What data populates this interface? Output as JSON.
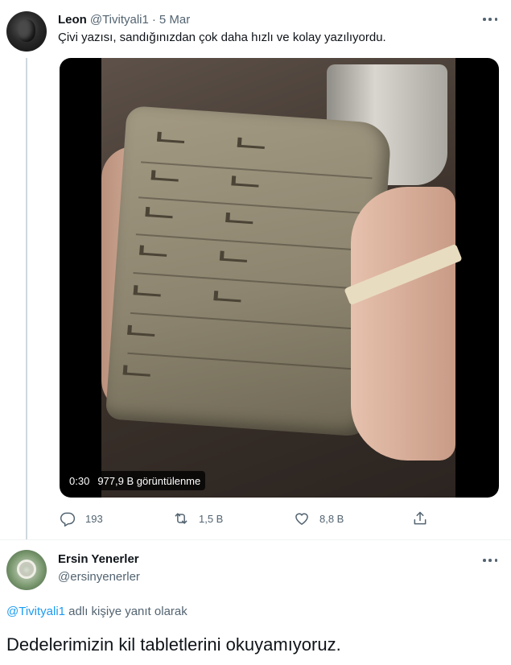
{
  "tweet": {
    "author_name": "Leon",
    "author_handle": "@Tivityali1",
    "separator": "·",
    "date": "5 Mar",
    "text": "Çivi yazısı, sandığınızdan çok daha hızlı ve kolay yazılıyordu.",
    "video": {
      "duration": "0:30",
      "views": "977,9 B görüntülenme"
    },
    "stats": {
      "replies": "193",
      "retweets": "1,5 B",
      "likes": "8,8 B"
    }
  },
  "reply": {
    "author_name": "Ersin Yenerler",
    "author_handle": "@ersinyenerler",
    "replying_to_handle": "@Tivityali1",
    "replying_to_suffix": " adlı kişiye yanıt olarak",
    "text": "Dedelerimizin kil tabletlerini okuyamıyoruz."
  },
  "colors": {
    "text_primary": "#0f1419",
    "text_secondary": "#536471",
    "link": "#1d9bf0",
    "divider": "#eff3f4"
  },
  "icons": [
    "more-icon",
    "reply-icon",
    "retweet-icon",
    "like-icon",
    "share-icon"
  ]
}
